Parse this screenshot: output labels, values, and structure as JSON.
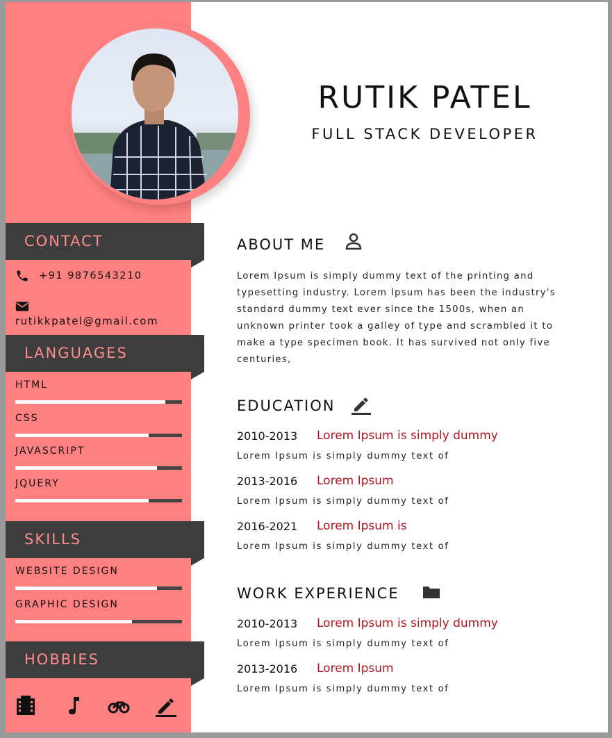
{
  "colors": {
    "sidebar": "#ff8080",
    "section_head": "#3d3d3d",
    "section_title": "#ff8c8c",
    "accent_red": "#b3131f"
  },
  "header": {
    "name": "RUTIK PATEL",
    "role": "FULL STACK DEVELOPER"
  },
  "sidebar": {
    "contact": {
      "title": "CONTACT",
      "phone_icon": "phone-icon",
      "phone": "+91 9876543210",
      "email_icon": "mail-icon",
      "email": "rutikkpatel@gmail.com"
    },
    "languages": {
      "title": "LANGUAGES",
      "items": [
        {
          "label": "HTML",
          "level": 0.9
        },
        {
          "label": "CSS",
          "level": 0.8
        },
        {
          "label": "JAVASCRIPT",
          "level": 0.85
        },
        {
          "label": "JQUERY",
          "level": 0.8
        }
      ]
    },
    "skills": {
      "title": "SKILLS",
      "items": [
        {
          "label": "WEBSITE DESIGN",
          "level": 0.85
        },
        {
          "label": "GRAPHIC DESIGN",
          "level": 0.7
        }
      ]
    },
    "hobbies": {
      "title": "HOBBIES",
      "icons": [
        "film-icon",
        "music-note-icon",
        "bike-icon",
        "pencil-icon"
      ]
    }
  },
  "about": {
    "title": "ABOUT ME",
    "icon": "person-icon",
    "text": "Lorem Ipsum is simply dummy text of the printing and typesetting industry. Lorem Ipsum has been the industry's standard dummy text ever since the 1500s, when an unknown printer took a galley of type and scrambled it to make a type specimen book. It has survived not only five centuries,"
  },
  "education": {
    "title": "EDUCATION",
    "icon": "pencil-icon",
    "entries": [
      {
        "years": "2010-2013",
        "title": "Lorem Ipsum is simply dummy",
        "desc": "Lorem Ipsum is simply dummy text of"
      },
      {
        "years": "2013-2016",
        "title": "Lorem Ipsum",
        "desc": "Lorem Ipsum is simply dummy text of"
      },
      {
        "years": "2016-2021",
        "title": "Lorem Ipsum is",
        "desc": "Lorem Ipsum is simply dummy text of"
      }
    ]
  },
  "work": {
    "title": "WORK EXPERIENCE",
    "icon": "folder-icon",
    "entries": [
      {
        "years": "2010-2013",
        "title": "Lorem Ipsum is simply dummy",
        "desc": "Lorem Ipsum is simply dummy text of"
      },
      {
        "years": "2013-2016",
        "title": "Lorem Ipsum",
        "desc": "Lorem Ipsum is simply dummy text of"
      }
    ]
  }
}
